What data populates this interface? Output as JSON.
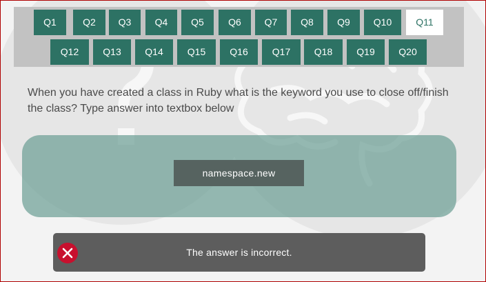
{
  "colors": {
    "button_bg": "#2d7264",
    "button_text": "#ffffff",
    "active_bg": "#ffffff",
    "active_text": "#2d7264",
    "nav_bg": "#c2c2c2",
    "answer_panel": "#8bb3aa",
    "answer_box": "#566360",
    "feedback_bg": "#5d5d5d",
    "error_red": "#c8102e"
  },
  "questions": [
    {
      "label": "Q1",
      "active": false
    },
    {
      "label": "Q2",
      "active": false
    },
    {
      "label": "Q3",
      "active": false
    },
    {
      "label": "Q4",
      "active": false
    },
    {
      "label": "Q5",
      "active": false
    },
    {
      "label": "Q6",
      "active": false
    },
    {
      "label": "Q7",
      "active": false
    },
    {
      "label": "Q8",
      "active": false
    },
    {
      "label": "Q9",
      "active": false
    },
    {
      "label": "Q10",
      "active": false
    },
    {
      "label": "Q11",
      "active": true
    },
    {
      "label": "Q12",
      "active": false
    },
    {
      "label": "Q13",
      "active": false
    },
    {
      "label": "Q14",
      "active": false
    },
    {
      "label": "Q15",
      "active": false
    },
    {
      "label": "Q16",
      "active": false
    },
    {
      "label": "Q17",
      "active": false
    },
    {
      "label": "Q18",
      "active": false
    },
    {
      "label": "Q19",
      "active": false
    },
    {
      "label": "Q20",
      "active": false
    }
  ],
  "question": {
    "text": "When you have created a class in Ruby what is the keyword you use to close off/finish the class? Type answer into textbox below"
  },
  "answer": {
    "value": "namespace.new"
  },
  "feedback": {
    "icon": "close-icon",
    "text": "The answer is incorrect."
  }
}
